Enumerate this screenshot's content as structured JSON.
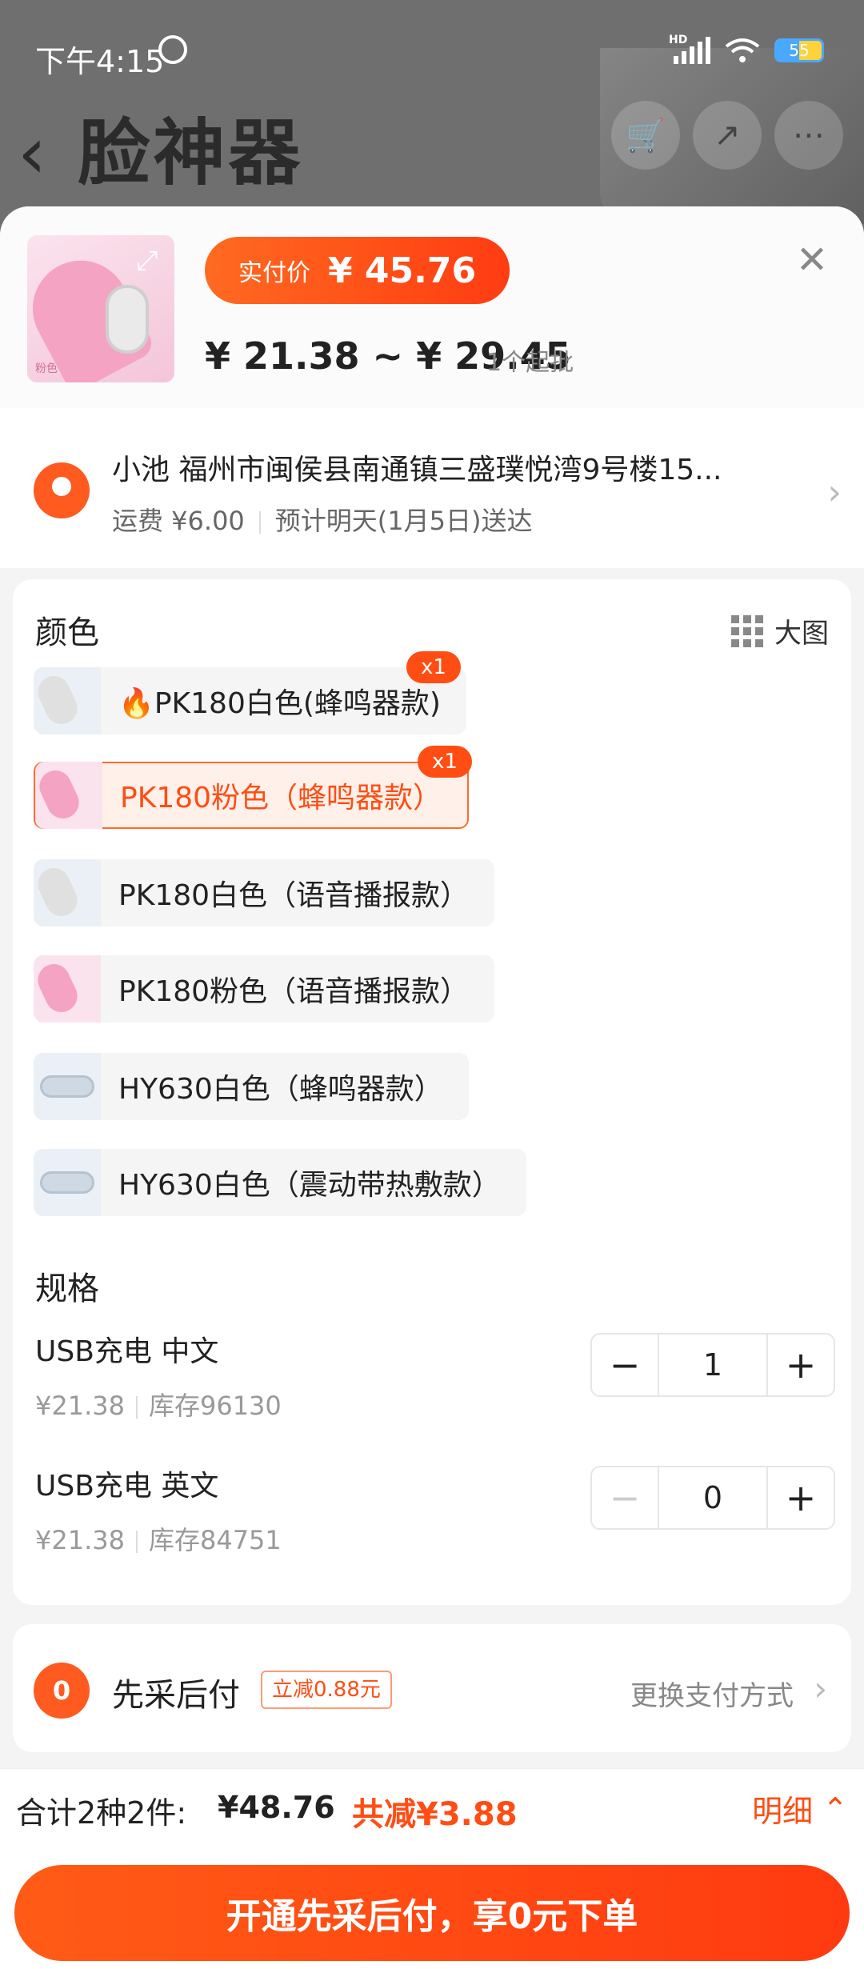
{
  "status_bar": {
    "time": "下午4:15",
    "battery": "55",
    "network_label": "HD"
  },
  "background_page": {
    "title": "脸神器"
  },
  "sheet": {
    "thumbnail_tag": "粉色",
    "paid_price_label": "实付价",
    "paid_price": "¥ 45.76",
    "price_range": "¥ 21.38 ~ ¥ 29.45",
    "min_order": "1个起批"
  },
  "address": {
    "line": "小池 福州市闽侯县南通镇三盛璞悦湾9号楼15...",
    "shipping_fee": "运费 ¥6.00",
    "delivery": "预计明天(1月5日)送达"
  },
  "color_section": {
    "label": "颜色",
    "big_view_label": "大图",
    "options": [
      {
        "label": "PK180白色(蜂鸣器款)",
        "badge": "x1",
        "hot": "🔥",
        "selected": false
      },
      {
        "label": "PK180粉色（蜂鸣器款）",
        "badge": "x1",
        "selected": true
      },
      {
        "label": "PK180白色（语音播报款）",
        "selected": false
      },
      {
        "label": "PK180粉色（语音播报款）",
        "selected": false
      },
      {
        "label": "HY630白色（蜂鸣器款）",
        "selected": false
      },
      {
        "label": "HY630白色（震动带热敷款）",
        "selected": false
      }
    ]
  },
  "spec_section": {
    "label": "规格",
    "items": [
      {
        "name": "USB充电 中文",
        "price": "¥21.38",
        "stock": "库存96130",
        "quantity": "1"
      },
      {
        "name": "USB充电 英文",
        "price": "¥21.38",
        "stock": "库存84751",
        "quantity": "0"
      }
    ]
  },
  "payment": {
    "title": "先采后付",
    "badge": "立减0.88元",
    "change_label": "更换支付方式"
  },
  "bottom_bar": {
    "total_label": "合计2种2件:",
    "total_amount": "¥48.76",
    "discount": "共减¥3.88",
    "detail_label": "明细",
    "cta": "开通先采后付，享0元下单"
  },
  "colors": {
    "accent": "#ff4d14",
    "accent_gradient_start": "#ff6a21"
  }
}
